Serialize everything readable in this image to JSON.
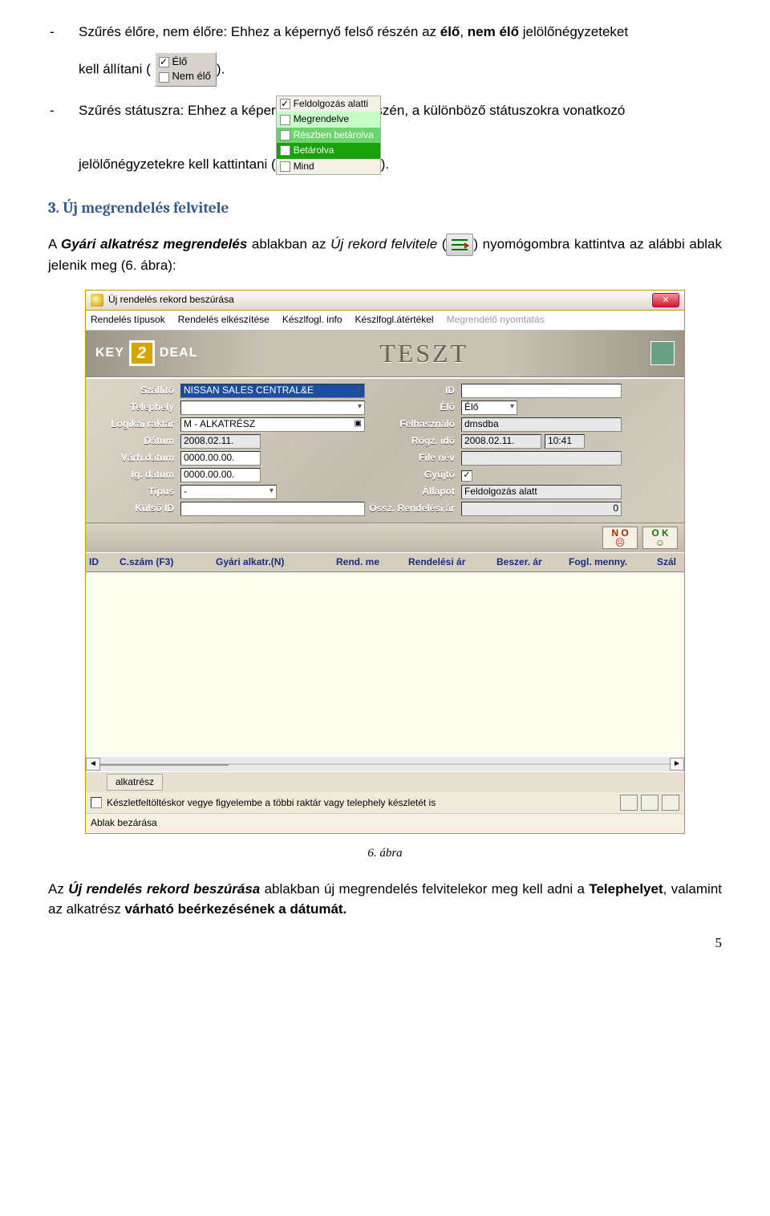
{
  "bullet1": {
    "dash": "-",
    "text_a": "Szűrés élőre, nem élőre: Ehhez a képernyő felső részén az ",
    "bold_a": "élő",
    "text_b": ", ",
    "bold_b": "nem élő",
    "text_c": " jelölőnégyzeteket",
    "line2_a": "kell állítani (",
    "line2_b": "."
  },
  "widget_elo": {
    "opt1": "Élő",
    "opt2": "Nem élő"
  },
  "bullet2": {
    "dash": "-",
    "text_a": "Szűrés státuszra: Ehhez a képernyő jobb felső részén, a különböző státuszokra vonatkozó",
    "line2_a": "jelölőnégyzetekre kell kattintani (",
    "line2_b": ")."
  },
  "status_opts": [
    "Feldolgozás alatti",
    "Megrendelve",
    "Részben betárolva",
    "Betárolva",
    "Mind"
  ],
  "section3": "3. Új megrendelés felvitele",
  "para3": {
    "t1": "A ",
    "bi1": "Gyári alkatrész megrendelés",
    "t2": " ablakban az ",
    "i1": "Új rekord felvitele",
    "t3": " (",
    "t4": ") nyomógombra kattintva az alábbi ablak jelenik meg (6. ábra):"
  },
  "dialog": {
    "title": "Új rendelés rekord beszúrása",
    "close": "✕",
    "menu": [
      "Rendelés típusok",
      "Rendelés elkészítése",
      "Készlfogl. info",
      "Készlfogl.átértékel",
      "Megrendelő nyomtatás"
    ],
    "brand_left": "KEY",
    "brand_num": "2",
    "brand_right": "DEAL",
    "brand_center": "TESZT",
    "labels": {
      "szallito": "Szállító",
      "id": "ID",
      "telephely": "Telephely",
      "elo": "Élő",
      "lograktar": "Logikai raktár",
      "felh": "Felhasználó",
      "datum": "Dátum",
      "rogz": "Rögz. idő",
      "varh": "Várh.dátum",
      "filenev": "File név",
      "igdat": "Ig. dátum",
      "gyujto": "Gyűjtő",
      "tipus": "Típus",
      "allapot": "Állapot",
      "kulso": "Külső ID",
      "ossz": "Össz. Rendelési ár"
    },
    "values": {
      "szallito": "NISSAN SALES CENTRAL&E",
      "id": "",
      "telephely": "",
      "elo": "Élő",
      "lograktar": "M - ALKATRÉSZ",
      "felh": "dmsdba",
      "datum": "2008.02.11.",
      "rogz1": "2008.02.11.",
      "rogz2": "10:41",
      "varh": "0000.00.00.",
      "filenev": "",
      "igdat": "0000.00.00.",
      "tipus": "-",
      "allapot": "Feldolgozás alatt",
      "kulso": "",
      "ossz": "0"
    },
    "nook": {
      "no": "N O",
      "ok": "O K"
    },
    "cols": [
      "ID",
      "C.szám (F3)",
      "Gyári alkatr.(N)",
      "Rend. me",
      "Rendelési ár",
      "Beszer. ár",
      "Fogl. menny.",
      "Szál"
    ],
    "footer_tab": "alkatrész",
    "footer_check": "Készletfeltöltéskor vegye figyelembe a többi raktár vagy telephely készletét is",
    "footer_close": "Ablak bezárása"
  },
  "caption6": "6. ábra",
  "para4": {
    "t1": "Az ",
    "bi1": "Új rendelés rekord beszúrása",
    "t2": " ablakban új megrendelés felvitelekor meg kell adni a ",
    "b1": "Telephelyet",
    "t3": ", valamint az alkatrész ",
    "b2": "várható beérkezésének a dátumát.",
    "t4": ""
  },
  "page_num": "5"
}
